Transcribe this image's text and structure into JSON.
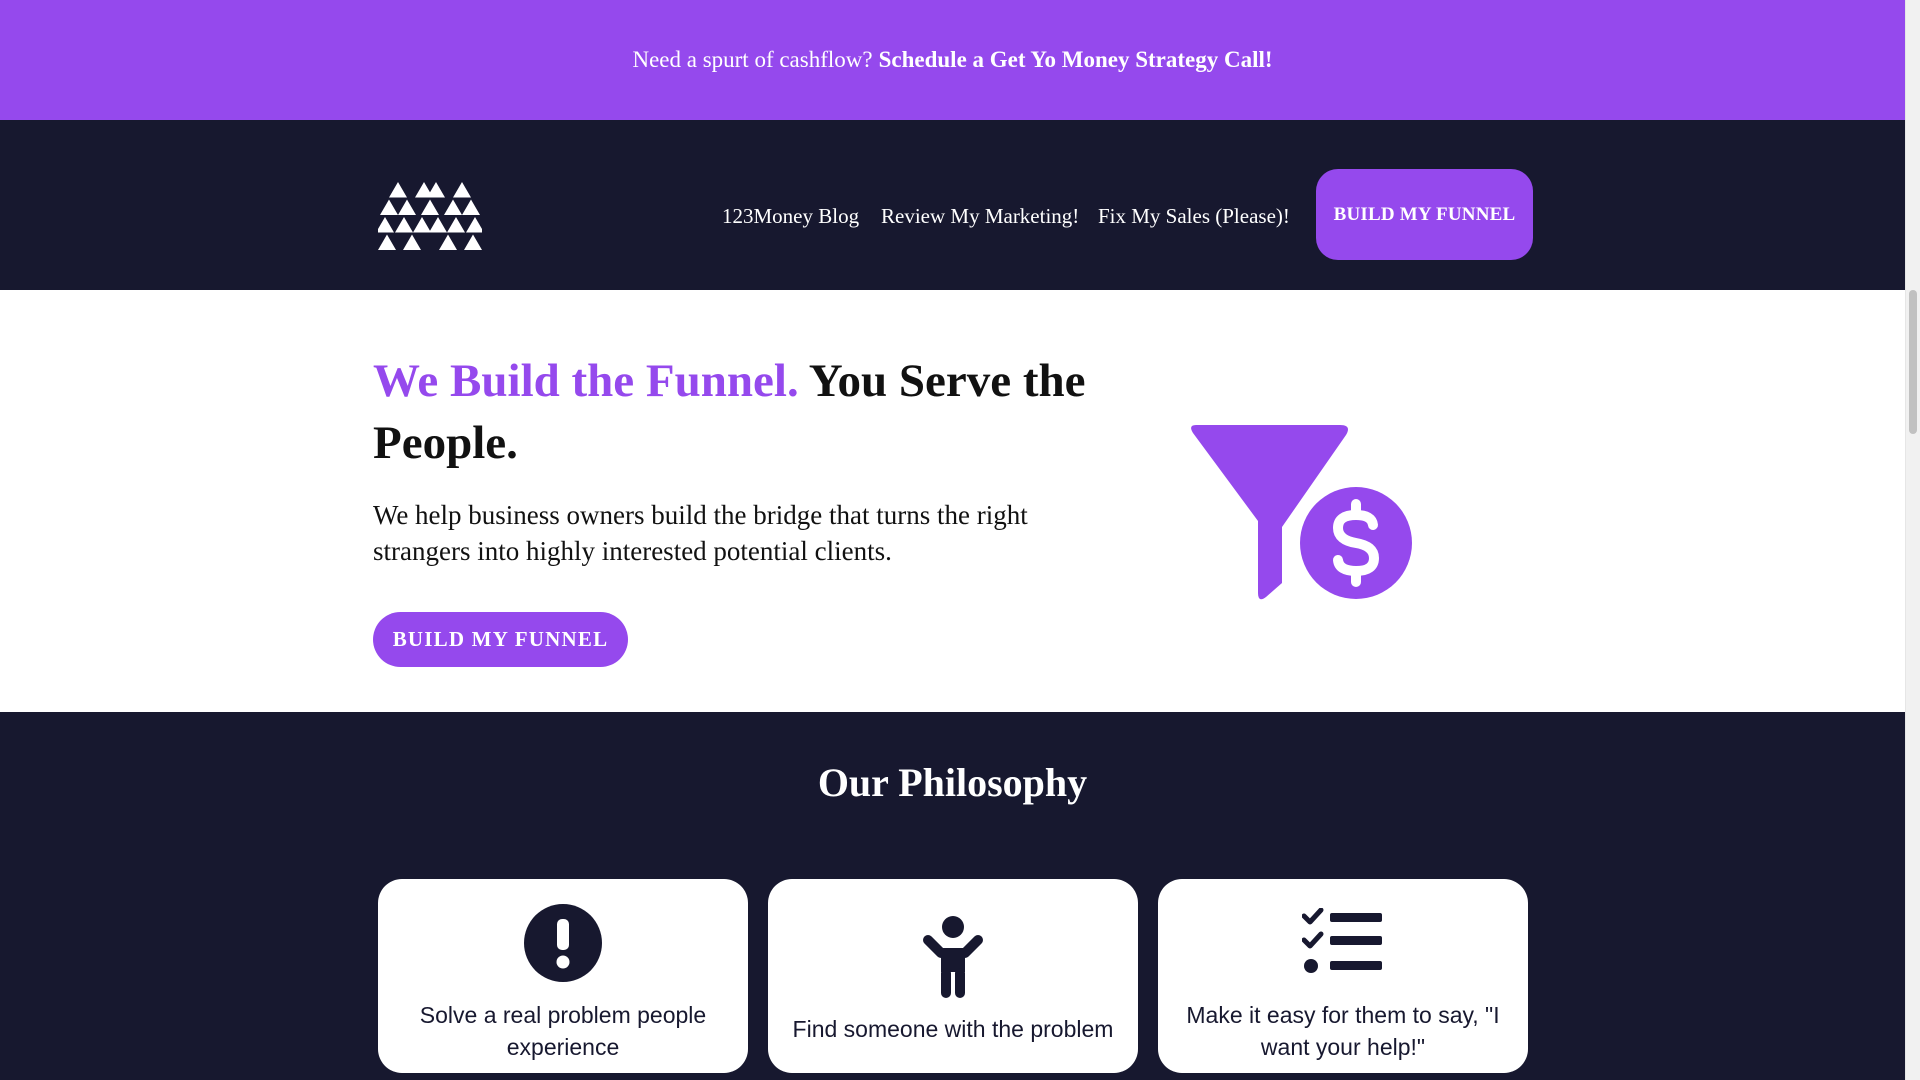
{
  "promo_bar": {
    "lead_text": "Need a spurt of cashflow?",
    "link_text": "Schedule a Get Yo Money Strategy Call!"
  },
  "nav": {
    "logo_icon": "triangle-m-logo-icon",
    "links": [
      {
        "label": "123Money Blog"
      },
      {
        "label": "Review My Marketing!"
      },
      {
        "label": "Fix My Sales (Please)!"
      }
    ],
    "cta_label": "BUILD MY FUNNEL"
  },
  "hero": {
    "title_accent": "We Build the Funnel.",
    "title_rest": "You Serve the People.",
    "description": "We help business owners build the bridge that turns the right strangers into highly interested potential clients.",
    "cta_label": "BUILD MY FUNNEL",
    "illustration_icon": "funnel-dollar-icon"
  },
  "philosophy": {
    "title": "Our Philosophy",
    "cards": [
      {
        "icon": "exclamation-circle-icon",
        "text": "Solve a real problem people experience"
      },
      {
        "icon": "person-icon",
        "text": "Find someone with the problem"
      },
      {
        "icon": "checklist-icon",
        "text": "Make it easy for them to say, \"I want your help!\""
      }
    ]
  },
  "colors": {
    "accent_purple": "#9549ed",
    "dark_navy": "#17182f",
    "white": "#ffffff",
    "text_dark": "#111111"
  }
}
